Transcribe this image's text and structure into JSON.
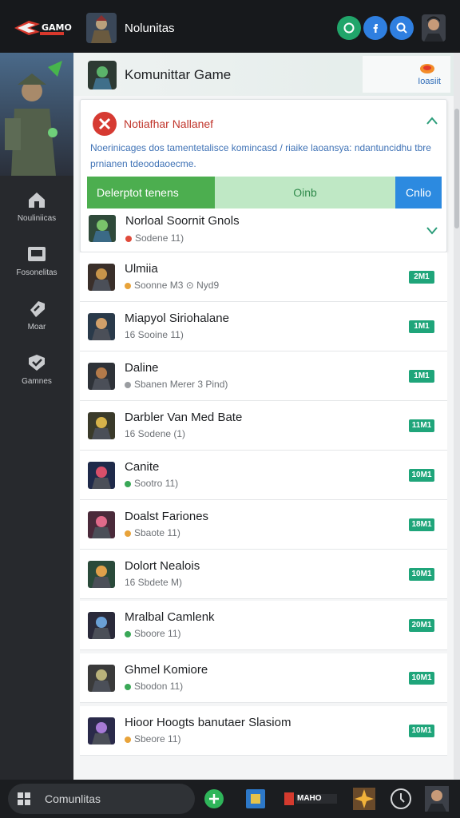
{
  "topbar": {
    "logo_text": "GAMO",
    "title": "Nolunitas",
    "buttons": [
      "chat-icon",
      "facebook-icon",
      "search-icon"
    ]
  },
  "sidebar": {
    "items": [
      {
        "label": "Nouliniicas",
        "icon": "home-icon"
      },
      {
        "label": "Fosonelitas",
        "icon": "window-icon"
      },
      {
        "label": "Moar",
        "icon": "tag-icon"
      },
      {
        "label": "Gamnes",
        "icon": "shield-icon"
      }
    ]
  },
  "header": {
    "title": "Komunittar Game",
    "badge_label": "Ioasiit"
  },
  "card": {
    "title": "Notiafhar Nallanef",
    "description": "Noerinicages dos tamentetalisce komincasd / riaike laoansya: ndantuncidhu tbre prnianen tdeoodaoecme.",
    "segments": [
      "Delerptot tenens",
      "Oinb",
      "Cnlio"
    ]
  },
  "rows": [
    {
      "name": "Norloal Soornit Gnols",
      "sub": "Sodene 11)",
      "dot": "#e04b3b",
      "badge": ""
    },
    {
      "name": "Ulmiia",
      "sub": "Soonne M3  ⊙ Nyd9",
      "dot": "#e8a33a",
      "badge": "2M1"
    },
    {
      "name": "Miapyol Siriohalane",
      "sub": "16 Sooine 11)",
      "dot": "",
      "badge": "1M1"
    },
    {
      "name": "Daline",
      "sub": "Sbanen Merer 3 Pind)",
      "dot": "#9a9da1",
      "badge": "1M1"
    },
    {
      "name": "Darbler Van Med Bate",
      "sub": "16 Sodene (1)",
      "dot": "",
      "badge": "11M1"
    },
    {
      "name": "Canite",
      "sub": "Sootro 11)",
      "dot": "#3aa857",
      "badge": "10M1"
    },
    {
      "name": "Doalst Fariones",
      "sub": "Sbaote 11)",
      "dot": "#e8a33a",
      "badge": "18M1"
    },
    {
      "name": "Dolort Nealois",
      "sub": "16 Sbdete M)",
      "dot": "",
      "badge": "10M1"
    },
    {
      "name": "Mralbal Camlenk",
      "sub": "Sboore 11)",
      "dot": "#3aa857",
      "badge": "20M1"
    },
    {
      "name": "Ghmel Komiore",
      "sub": "Sbodon 11)",
      "dot": "#3aa857",
      "badge": "10M1"
    },
    {
      "name": "Hioor Hoogts banutaer Slasiom",
      "sub": "Sbeore 11)",
      "dot": "#e8a33a",
      "badge": "10M1"
    }
  ],
  "taskbar": {
    "search_label": "Comunlitas",
    "app_label": "MAHO"
  }
}
